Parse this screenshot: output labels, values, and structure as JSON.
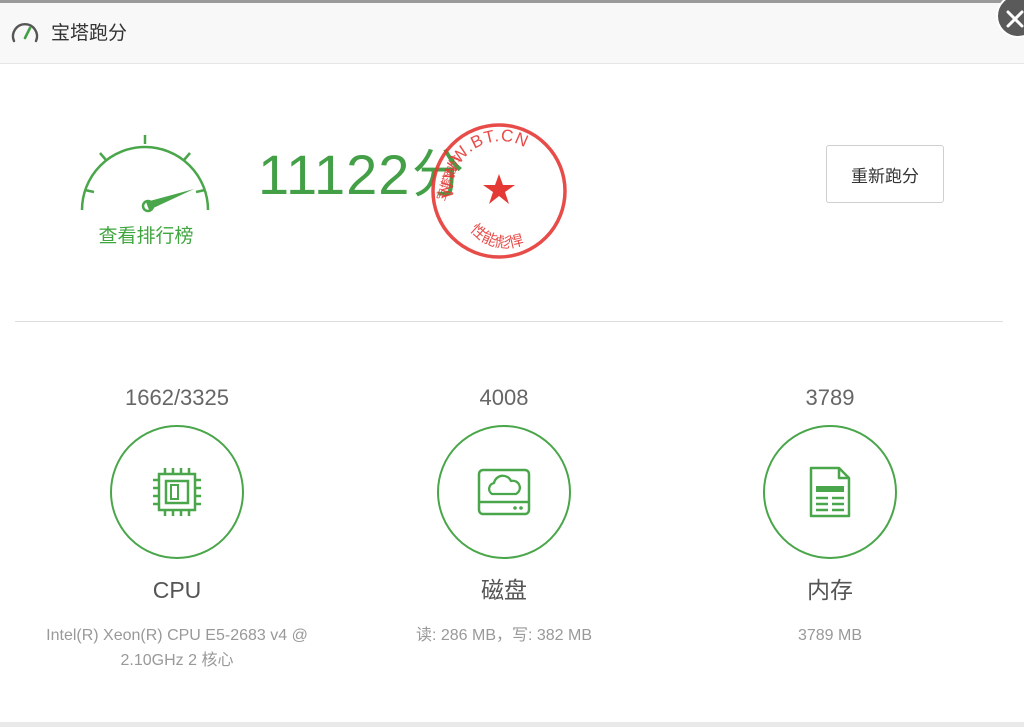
{
  "window": {
    "title": "宝塔跑分",
    "title_icon": "speedometer-icon",
    "close_icon": "close-icon"
  },
  "summary": {
    "score": "11122",
    "score_unit": "分",
    "rank_link_label": "查看排行榜",
    "rerun_button_label": "重新跑分"
  },
  "seal": {
    "ring_text": "WWW.BT.CN",
    "side_text": "宝塔跑分",
    "bottom_text": "性能彪悍",
    "color": "#e53935"
  },
  "metrics": [
    {
      "score": "1662/3325",
      "name": "CPU",
      "detail": "Intel(R) Xeon(R) CPU E5-2683 v4 @ 2.10GHz 2 核心",
      "icon": "cpu-chip-icon"
    },
    {
      "score": "4008",
      "name": "磁盘",
      "detail": "读: 286 MB，写: 382 MB",
      "icon": "disk-cloud-icon"
    },
    {
      "score": "3789",
      "name": "内存",
      "detail": "3789 MB",
      "icon": "memory-doc-icon"
    }
  ],
  "colors": {
    "accent_green": "#43a047",
    "seal_red": "#e53935",
    "text_gray": "#666666"
  }
}
